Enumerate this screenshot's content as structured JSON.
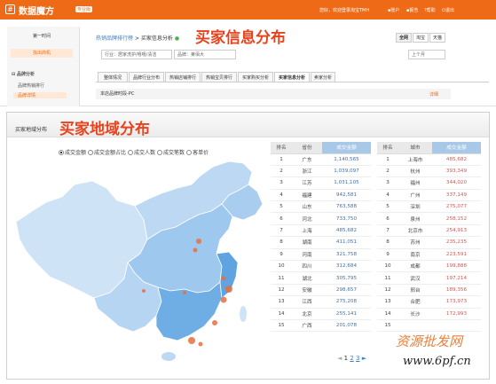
{
  "topbar": {
    "logo_glyph": "#",
    "brand": "数据魔方",
    "badge": "专业版",
    "welcome": "您好，欢迎登录淘宝TMH",
    "nav": [
      "账户",
      "报告",
      "帮助",
      "退出"
    ]
  },
  "sidebar": {
    "title": "第一时间",
    "highlight": "找出商机",
    "section": "品牌分析",
    "items": [
      "品牌热销排行",
      "品牌详情"
    ]
  },
  "breadcrumb": {
    "link": "热销品牌排行榜",
    "sep": ">",
    "current": "买家信息分析"
  },
  "annotation_top": "买家信息分布",
  "toggles": [
    "全网",
    "淘宝",
    "天猫"
  ],
  "filters": {
    "industry": "行业：居家洗护/嘻嘻/清洁",
    "brand": "品牌：莱佰大",
    "period": "上个月"
  },
  "tabs": [
    "整体情况",
    "品牌行业分布",
    "热销店铺排行",
    "热销宝贝排行",
    "买家购买分析",
    "买家信息分析",
    "卖家分析"
  ],
  "active_tab": 5,
  "subpanel": "本店品牌时段-PC",
  "more_link": "详细",
  "panel_title": "买家地域分布",
  "annotation_bottom": "买家地域分布",
  "radio_options": [
    "成交金额",
    "成交金额占比",
    "成交人数",
    "成交笔数",
    "客单价"
  ],
  "table_left": {
    "headers": [
      "排名",
      "省份",
      "成交金额"
    ],
    "rows": [
      [
        "1",
        "广东",
        "1,140,565"
      ],
      [
        "2",
        "浙江",
        "1,039,097"
      ],
      [
        "3",
        "江苏",
        "1,031,105"
      ],
      [
        "4",
        "福建",
        "942,581"
      ],
      [
        "5",
        "山东",
        "763,588"
      ],
      [
        "6",
        "河北",
        "733,750"
      ],
      [
        "7",
        "上海",
        "485,682"
      ],
      [
        "8",
        "湖南",
        "411,051"
      ],
      [
        "9",
        "河南",
        "321,758"
      ],
      [
        "10",
        "四川",
        "312,684"
      ],
      [
        "11",
        "湖北",
        "305,795"
      ],
      [
        "12",
        "安徽",
        "298,657"
      ],
      [
        "13",
        "江西",
        "275,208"
      ],
      [
        "14",
        "北京",
        "255,141"
      ],
      [
        "15",
        "广西",
        "201,078"
      ]
    ]
  },
  "table_right": {
    "headers": [
      "排名",
      "城市",
      "成交金额"
    ],
    "rows": [
      [
        "1",
        "上海市",
        "485,682"
      ],
      [
        "2",
        "杭州",
        "393,349"
      ],
      [
        "3",
        "福州",
        "344,020"
      ],
      [
        "4",
        "广州",
        "337,149"
      ],
      [
        "5",
        "深圳",
        "275,077"
      ],
      [
        "6",
        "泉州",
        "258,152"
      ],
      [
        "7",
        "北京市",
        "254,913"
      ],
      [
        "8",
        "苏州",
        "235,235"
      ],
      [
        "9",
        "南京",
        "223,591"
      ],
      [
        "10",
        "成都",
        "199,888"
      ],
      [
        "11",
        "武汉",
        "197,214"
      ],
      [
        "12",
        "邢台",
        "189,356"
      ],
      [
        "13",
        "合肥",
        "173,973"
      ],
      [
        "14",
        "长沙",
        "172,993"
      ],
      [
        "15",
        "",
        ""
      ]
    ]
  },
  "pager": {
    "prev": "◄",
    "pages": [
      "1",
      "2",
      "3"
    ],
    "next": "►"
  },
  "watermark": {
    "line1": "资源批发网",
    "line2": "www.6pf.cn"
  },
  "colors": {
    "brand": "#ef6a16",
    "annotation": "#e8431d",
    "map_fill": "#9ec8ee",
    "map_dark": "#5fa3e0",
    "bubble": "#e5703f"
  }
}
